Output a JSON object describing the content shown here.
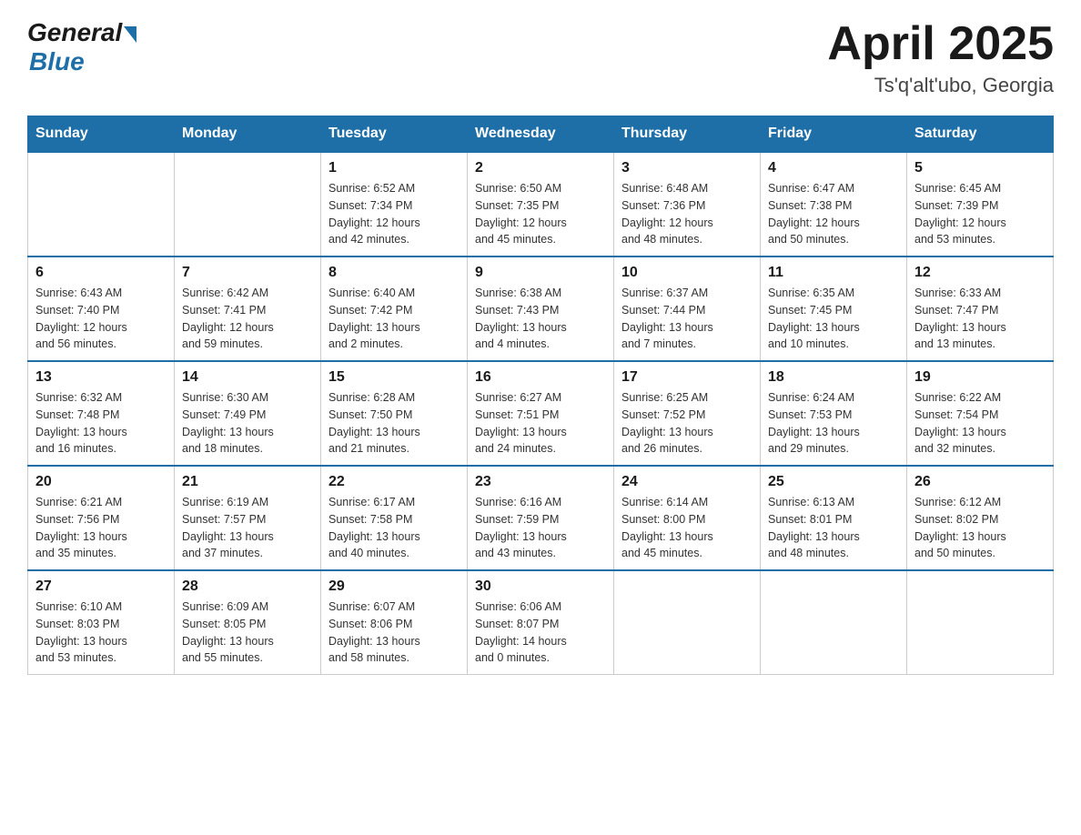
{
  "header": {
    "logo": {
      "general": "General",
      "blue": "Blue"
    },
    "title": "April 2025",
    "location": "Ts'q'alt'ubo, Georgia"
  },
  "weekdays": [
    "Sunday",
    "Monday",
    "Tuesday",
    "Wednesday",
    "Thursday",
    "Friday",
    "Saturday"
  ],
  "weeks": [
    [
      {
        "day": "",
        "info": ""
      },
      {
        "day": "",
        "info": ""
      },
      {
        "day": "1",
        "info": "Sunrise: 6:52 AM\nSunset: 7:34 PM\nDaylight: 12 hours\nand 42 minutes."
      },
      {
        "day": "2",
        "info": "Sunrise: 6:50 AM\nSunset: 7:35 PM\nDaylight: 12 hours\nand 45 minutes."
      },
      {
        "day": "3",
        "info": "Sunrise: 6:48 AM\nSunset: 7:36 PM\nDaylight: 12 hours\nand 48 minutes."
      },
      {
        "day": "4",
        "info": "Sunrise: 6:47 AM\nSunset: 7:38 PM\nDaylight: 12 hours\nand 50 minutes."
      },
      {
        "day": "5",
        "info": "Sunrise: 6:45 AM\nSunset: 7:39 PM\nDaylight: 12 hours\nand 53 minutes."
      }
    ],
    [
      {
        "day": "6",
        "info": "Sunrise: 6:43 AM\nSunset: 7:40 PM\nDaylight: 12 hours\nand 56 minutes."
      },
      {
        "day": "7",
        "info": "Sunrise: 6:42 AM\nSunset: 7:41 PM\nDaylight: 12 hours\nand 59 minutes."
      },
      {
        "day": "8",
        "info": "Sunrise: 6:40 AM\nSunset: 7:42 PM\nDaylight: 13 hours\nand 2 minutes."
      },
      {
        "day": "9",
        "info": "Sunrise: 6:38 AM\nSunset: 7:43 PM\nDaylight: 13 hours\nand 4 minutes."
      },
      {
        "day": "10",
        "info": "Sunrise: 6:37 AM\nSunset: 7:44 PM\nDaylight: 13 hours\nand 7 minutes."
      },
      {
        "day": "11",
        "info": "Sunrise: 6:35 AM\nSunset: 7:45 PM\nDaylight: 13 hours\nand 10 minutes."
      },
      {
        "day": "12",
        "info": "Sunrise: 6:33 AM\nSunset: 7:47 PM\nDaylight: 13 hours\nand 13 minutes."
      }
    ],
    [
      {
        "day": "13",
        "info": "Sunrise: 6:32 AM\nSunset: 7:48 PM\nDaylight: 13 hours\nand 16 minutes."
      },
      {
        "day": "14",
        "info": "Sunrise: 6:30 AM\nSunset: 7:49 PM\nDaylight: 13 hours\nand 18 minutes."
      },
      {
        "day": "15",
        "info": "Sunrise: 6:28 AM\nSunset: 7:50 PM\nDaylight: 13 hours\nand 21 minutes."
      },
      {
        "day": "16",
        "info": "Sunrise: 6:27 AM\nSunset: 7:51 PM\nDaylight: 13 hours\nand 24 minutes."
      },
      {
        "day": "17",
        "info": "Sunrise: 6:25 AM\nSunset: 7:52 PM\nDaylight: 13 hours\nand 26 minutes."
      },
      {
        "day": "18",
        "info": "Sunrise: 6:24 AM\nSunset: 7:53 PM\nDaylight: 13 hours\nand 29 minutes."
      },
      {
        "day": "19",
        "info": "Sunrise: 6:22 AM\nSunset: 7:54 PM\nDaylight: 13 hours\nand 32 minutes."
      }
    ],
    [
      {
        "day": "20",
        "info": "Sunrise: 6:21 AM\nSunset: 7:56 PM\nDaylight: 13 hours\nand 35 minutes."
      },
      {
        "day": "21",
        "info": "Sunrise: 6:19 AM\nSunset: 7:57 PM\nDaylight: 13 hours\nand 37 minutes."
      },
      {
        "day": "22",
        "info": "Sunrise: 6:17 AM\nSunset: 7:58 PM\nDaylight: 13 hours\nand 40 minutes."
      },
      {
        "day": "23",
        "info": "Sunrise: 6:16 AM\nSunset: 7:59 PM\nDaylight: 13 hours\nand 43 minutes."
      },
      {
        "day": "24",
        "info": "Sunrise: 6:14 AM\nSunset: 8:00 PM\nDaylight: 13 hours\nand 45 minutes."
      },
      {
        "day": "25",
        "info": "Sunrise: 6:13 AM\nSunset: 8:01 PM\nDaylight: 13 hours\nand 48 minutes."
      },
      {
        "day": "26",
        "info": "Sunrise: 6:12 AM\nSunset: 8:02 PM\nDaylight: 13 hours\nand 50 minutes."
      }
    ],
    [
      {
        "day": "27",
        "info": "Sunrise: 6:10 AM\nSunset: 8:03 PM\nDaylight: 13 hours\nand 53 minutes."
      },
      {
        "day": "28",
        "info": "Sunrise: 6:09 AM\nSunset: 8:05 PM\nDaylight: 13 hours\nand 55 minutes."
      },
      {
        "day": "29",
        "info": "Sunrise: 6:07 AM\nSunset: 8:06 PM\nDaylight: 13 hours\nand 58 minutes."
      },
      {
        "day": "30",
        "info": "Sunrise: 6:06 AM\nSunset: 8:07 PM\nDaylight: 14 hours\nand 0 minutes."
      },
      {
        "day": "",
        "info": ""
      },
      {
        "day": "",
        "info": ""
      },
      {
        "day": "",
        "info": ""
      }
    ]
  ]
}
